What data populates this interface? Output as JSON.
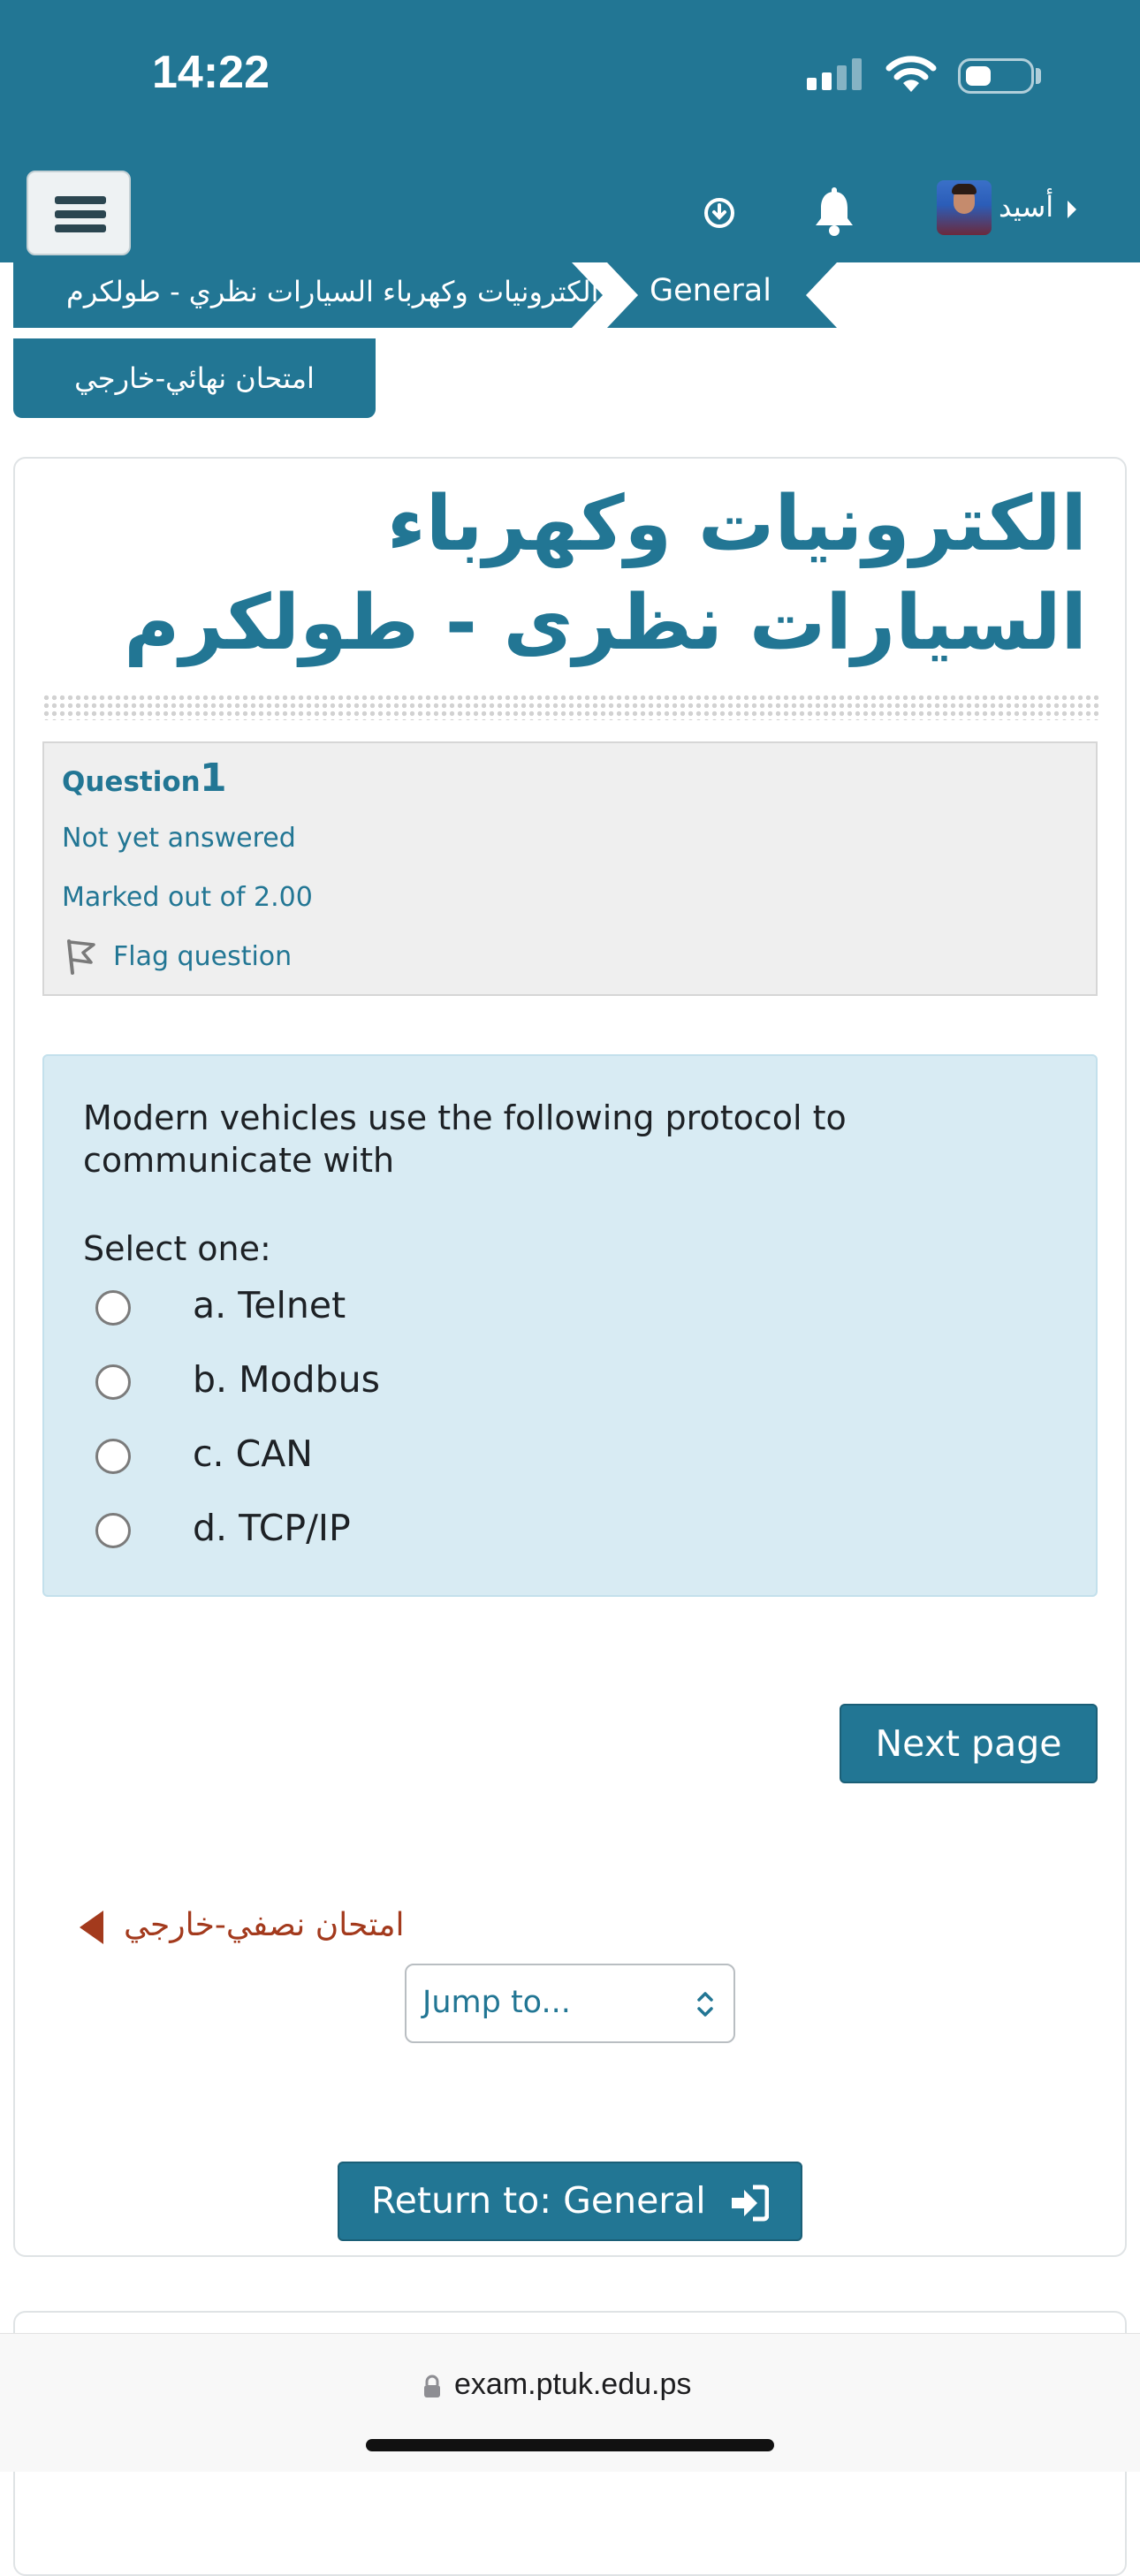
{
  "status_bar": {
    "time": "14:22"
  },
  "navbar": {
    "user_name": "أسيد"
  },
  "breadcrumb": {
    "items": [
      {
        "label": "General"
      },
      {
        "label": "الكترونيات وكهرباء السيارات نظري - طولكرم"
      }
    ]
  },
  "page_tab": {
    "label": "امتحان نهائي-خارجي"
  },
  "page": {
    "heading": "الكترونيات وكهرباء السيارات نظرى - طولكرم"
  },
  "question": {
    "label": "Question",
    "number": "1",
    "state": "Not yet answered",
    "grade": "Marked out of 2.00",
    "flag_label": "Flag question",
    "text": "Modern vehicles use the following protocol to communicate with",
    "prompt": "Select one:",
    "options": [
      {
        "label": "a. Telnet",
        "selected": false
      },
      {
        "label": "b. Modbus",
        "selected": false
      },
      {
        "label": "c. CAN",
        "selected": false
      },
      {
        "label": "d. TCP/IP",
        "selected": false
      }
    ]
  },
  "navigation": {
    "next_label": "Next page",
    "prev_activity": "امتحان نصفي-خارجي",
    "jump_placeholder": "Jump to...",
    "return_label": "Return to: General"
  },
  "browser": {
    "url": "exam.ptuk.edu.ps"
  },
  "colors": {
    "brand": "#227694",
    "link_prev": "#a33a1d",
    "question_bg": "#d8ebf3",
    "info_bg": "#efefef"
  }
}
